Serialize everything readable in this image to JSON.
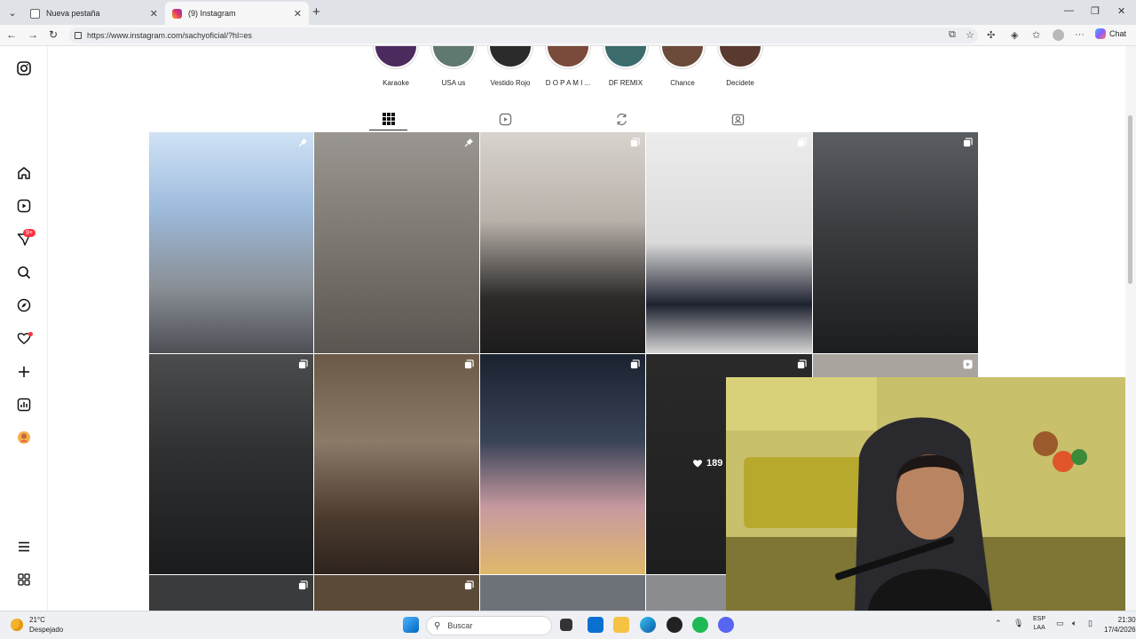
{
  "browser": {
    "tabs": [
      {
        "title": "Nueva pestaña",
        "active": false
      },
      {
        "title": "(9) Instagram",
        "active": true
      }
    ],
    "url": "https://www.instagram.com/sachyoficial/?hl=es",
    "chat_label": "Chat"
  },
  "instagram": {
    "nav": {
      "notification_badge": "9+",
      "items": [
        "logo-icon",
        "home-icon",
        "reels-icon",
        "messages-icon",
        "search-icon",
        "explore-icon",
        "notifications-icon",
        "create-icon",
        "dashboard-icon",
        "profile-avatar",
        "menu-icon",
        "threads-icon"
      ]
    },
    "highlights": [
      {
        "label": "Karaoke",
        "color": "#4b2a5e"
      },
      {
        "label": "USA us",
        "color": "#5f7870"
      },
      {
        "label": "Vestido Rojo",
        "color": "#2b2b2b"
      },
      {
        "label": "D O P A M I ...",
        "color": "#7a4a3a"
      },
      {
        "label": "DF REMIX",
        "color": "#3b6b6b"
      },
      {
        "label": "Chance",
        "color": "#6b4a3a"
      },
      {
        "label": "Decidete",
        "color": "#5a3a30"
      }
    ],
    "profile_tabs": [
      "posts-grid-icon",
      "reels-tab-icon",
      "reposts-icon",
      "tagged-icon"
    ],
    "posts": [
      {
        "marker": "pin",
        "bg": "#8a9bb0"
      },
      {
        "marker": "pin",
        "bg": "#8b8782"
      },
      {
        "marker": "carousel",
        "bg": "#bfb9b3"
      },
      {
        "marker": "carousel",
        "bg": "#d8d8d8"
      },
      {
        "marker": "carousel",
        "bg": "#3d3f42"
      },
      {
        "marker": "carousel",
        "bg": "#3c3c3e"
      },
      {
        "marker": "carousel",
        "bg": "#5e4a3a"
      },
      {
        "marker": "carousel",
        "bg": "#2c3340"
      },
      {
        "marker": "carousel",
        "bg": "#2b2b2b"
      },
      {
        "marker": "reel",
        "bg": "#aaa59e"
      }
    ],
    "hover_likes": "189"
  },
  "taskbar": {
    "temperature": "21°C",
    "weather": "Despejado",
    "search_placeholder": "Buscar",
    "lang_top": "ESP",
    "lang_bottom": "LAA",
    "time": "21:30",
    "date": "17/4/2026"
  }
}
